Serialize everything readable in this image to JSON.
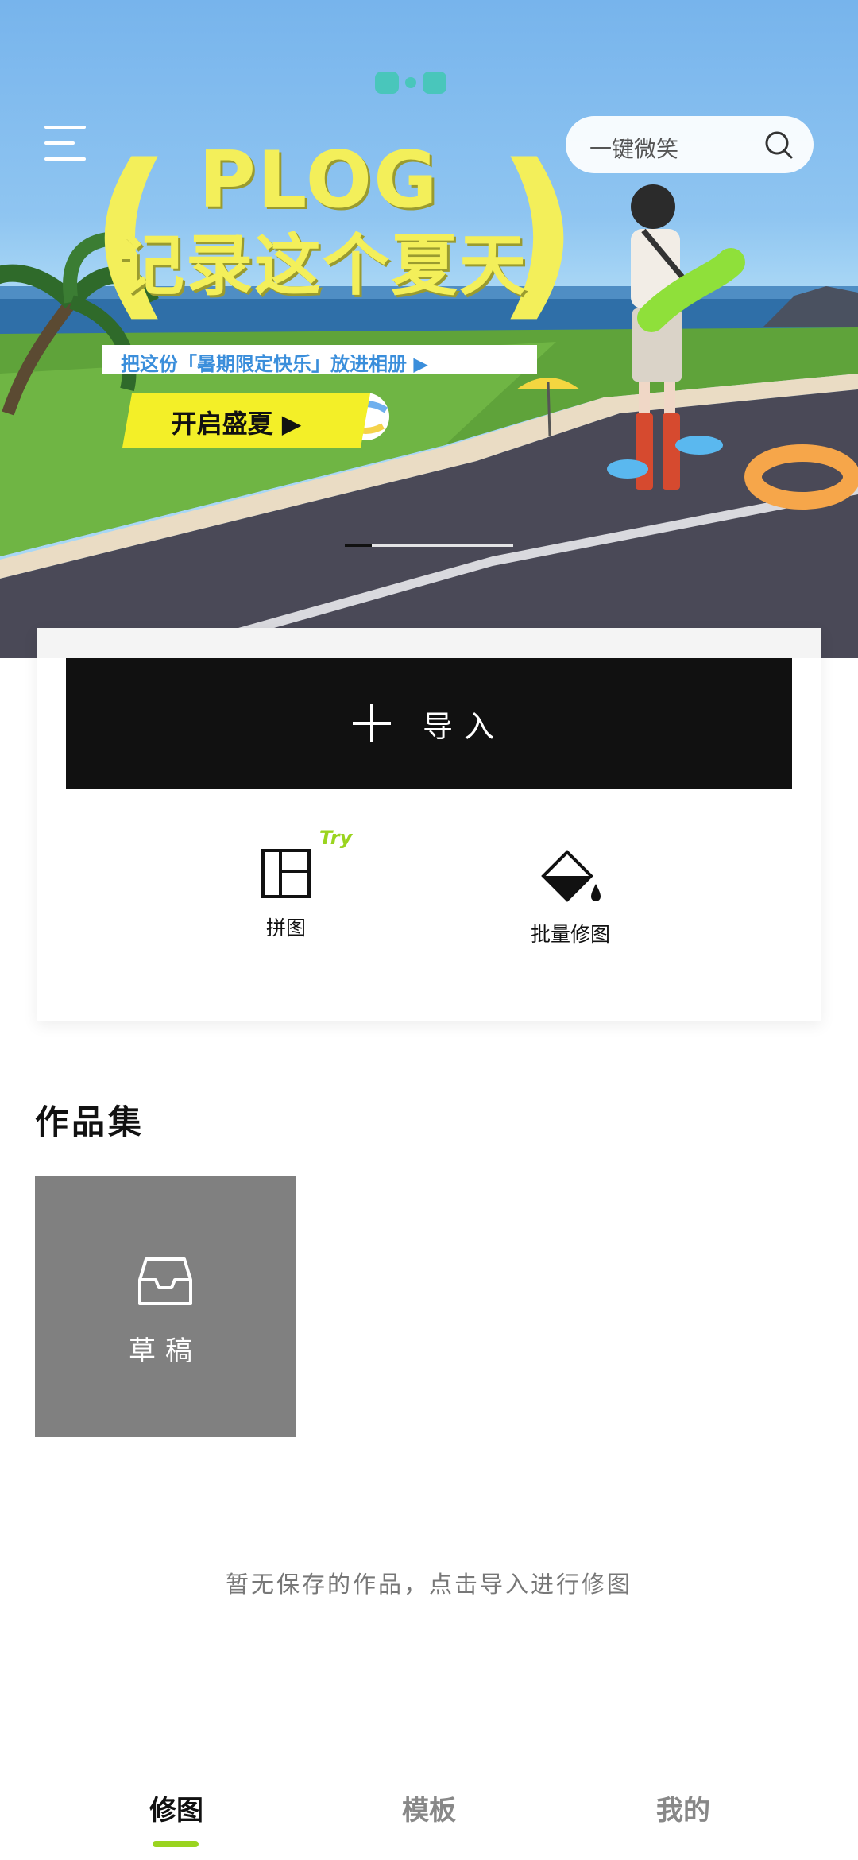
{
  "banner": {
    "headline_en": "PLOG",
    "headline_cn": "记录这个夏天",
    "subline": "把这份「暑期限定快乐」放进相册 ▶",
    "cta_label": "开启盛夏 ▶",
    "carousel": {
      "slide_count": 5,
      "active_index": 0
    }
  },
  "header": {
    "search_placeholder": "一键微笑",
    "icons": {
      "menu": "menu-icon",
      "search": "search-icon"
    }
  },
  "actions": {
    "import_label": "导入",
    "tools": [
      {
        "label": "拼图",
        "icon": "collage-icon",
        "badge": "Try"
      },
      {
        "label": "批量修图",
        "icon": "batch-edit-icon"
      }
    ]
  },
  "gallery": {
    "title": "作品集",
    "draft_label": "草稿",
    "draft_icon": "inbox-icon",
    "empty_text": "暂无保存的作品，点击导入进行修图"
  },
  "tabs": [
    {
      "label": "修图",
      "active": true
    },
    {
      "label": "模板",
      "active": false
    },
    {
      "label": "我的",
      "active": false
    }
  ],
  "colors": {
    "accent": "#9ad41f",
    "button_dark": "#111111",
    "banner_yellow": "#f3ef5a"
  }
}
